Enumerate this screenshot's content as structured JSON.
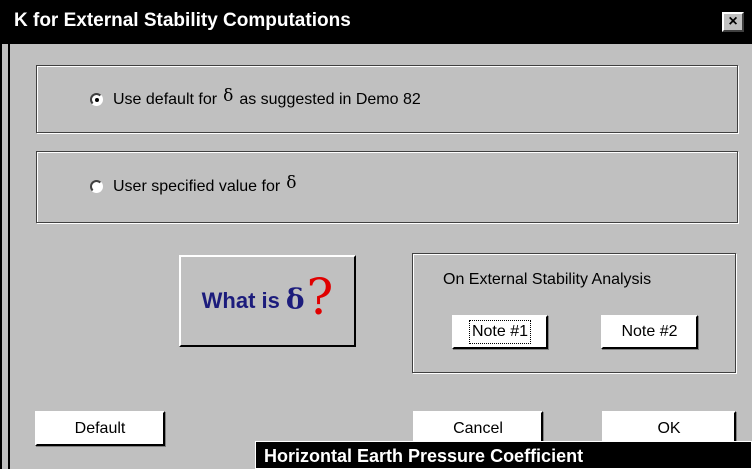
{
  "window": {
    "title": "K for External Stability Computations",
    "close_label": "×"
  },
  "options": {
    "default": {
      "label_before": "Use default for",
      "symbol": "δ",
      "label_after": "as suggested in Demo 82",
      "checked": true
    },
    "user": {
      "label_before": "User specified value for",
      "symbol": "δ",
      "checked": false
    }
  },
  "what_is": {
    "text": "What is",
    "symbol": "δ",
    "question": "?"
  },
  "notes_group": {
    "title": "On External Stability Analysis",
    "note1": "Note #1",
    "note2": "Note #2"
  },
  "buttons": {
    "default": "Default",
    "cancel": "Cancel",
    "ok": "OK"
  },
  "tooltip": {
    "text": "Horizontal Earth Pressure Coefficient"
  }
}
